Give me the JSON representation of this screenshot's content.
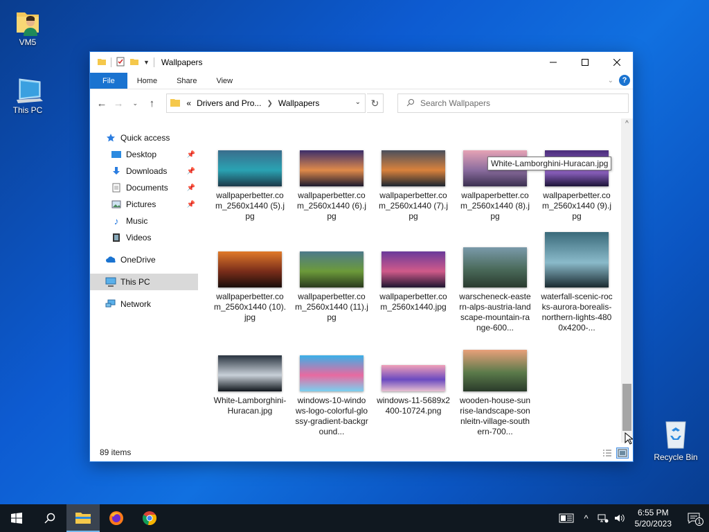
{
  "desktop": {
    "icons": [
      {
        "label": "VM5"
      },
      {
        "label": "This PC"
      },
      {
        "label": "Recycle Bin"
      }
    ]
  },
  "window": {
    "title": "Wallpapers",
    "ribbon_tabs": [
      "File",
      "Home",
      "Share",
      "View"
    ],
    "address": {
      "root_chevron": "«",
      "crumb1": "Drivers and Pro...",
      "crumb2": "Wallpapers"
    },
    "search": {
      "placeholder": "Search Wallpapers"
    },
    "status": {
      "items": "89 items"
    },
    "tooltip": "White-Lamborghini-Huracan.jpg"
  },
  "navpane": {
    "items": [
      {
        "label": "Quick access"
      },
      {
        "label": "Desktop"
      },
      {
        "label": "Downloads"
      },
      {
        "label": "Documents"
      },
      {
        "label": "Pictures"
      },
      {
        "label": "Music"
      },
      {
        "label": "Videos"
      },
      {
        "label": "OneDrive"
      },
      {
        "label": "This PC"
      },
      {
        "label": "Network"
      }
    ]
  },
  "files": [
    {
      "name": "wallpaperbetter.com_2560x1440 (5).jpg",
      "colors": [
        "#3a6d8c",
        "#2aa3b3",
        "#1d3a4a"
      ]
    },
    {
      "name": "wallpaperbetter.com_2560x1440 (6).jpg",
      "colors": [
        "#3b2e6b",
        "#e08a4a",
        "#1c1a2e"
      ]
    },
    {
      "name": "wallpaperbetter.com_2560x1440 (7).jpg",
      "colors": [
        "#4a4f5c",
        "#d9823c",
        "#1c2530"
      ]
    },
    {
      "name": "wallpaperbetter.com_2560x1440 (8).jpg",
      "colors": [
        "#e6a3b5",
        "#8a6c9e",
        "#3b3050"
      ]
    },
    {
      "name": "wallpaperbetter.com_2560x1440 (9).jpg",
      "colors": [
        "#4a2d7a",
        "#9a6ad0",
        "#1d1438"
      ]
    },
    {
      "name": "wallpaperbetter.com_2560x1440 (10).jpg",
      "colors": [
        "#e07a2a",
        "#7a2d1a",
        "#1a0e0a"
      ]
    },
    {
      "name": "wallpaperbetter.com_2560x1440 (11).jpg",
      "colors": [
        "#4d7a8a",
        "#6c9a3a",
        "#2a3a1e"
      ]
    },
    {
      "name": "wallpaperbetter.com_2560x1440.jpg",
      "colors": [
        "#6a3a9a",
        "#d05a8a",
        "#1e1630"
      ]
    },
    {
      "name": "warscheneck-eastern-alps-austria-landscape-mountain-range-600...",
      "colors": [
        "#7a9aaa",
        "#4a6a5a",
        "#2a3a2e"
      ]
    },
    {
      "name": "waterfall-scenic-rocks-aurora-borealis-northern-lights-4800x4200-...",
      "colors": [
        "#3a6a7a",
        "#8abaca",
        "#1a2a30"
      ]
    },
    {
      "name": "White-Lamborghini-Huracan.jpg",
      "colors": [
        "#2a3440",
        "#c8d0d8",
        "#10161c"
      ]
    },
    {
      "name": "windows-10-windows-logo-colorful-glossy-gradient-background...",
      "colors": [
        "#3ab0e8",
        "#e86aa0",
        "#7ad0f0"
      ]
    },
    {
      "name": "windows-11-5689x2400-10724.png",
      "colors": [
        "#f0a0b8",
        "#6a4ac0",
        "#e8c0d0"
      ]
    },
    {
      "name": "wooden-house-sunrise-landscape-sonnleitn-village-southern-700...",
      "colors": [
        "#e8a07a",
        "#5a7a4a",
        "#2a3a2a"
      ]
    }
  ],
  "taskbar": {
    "time": "6:55 PM",
    "date": "5/20/2023",
    "notif_count": "1"
  }
}
